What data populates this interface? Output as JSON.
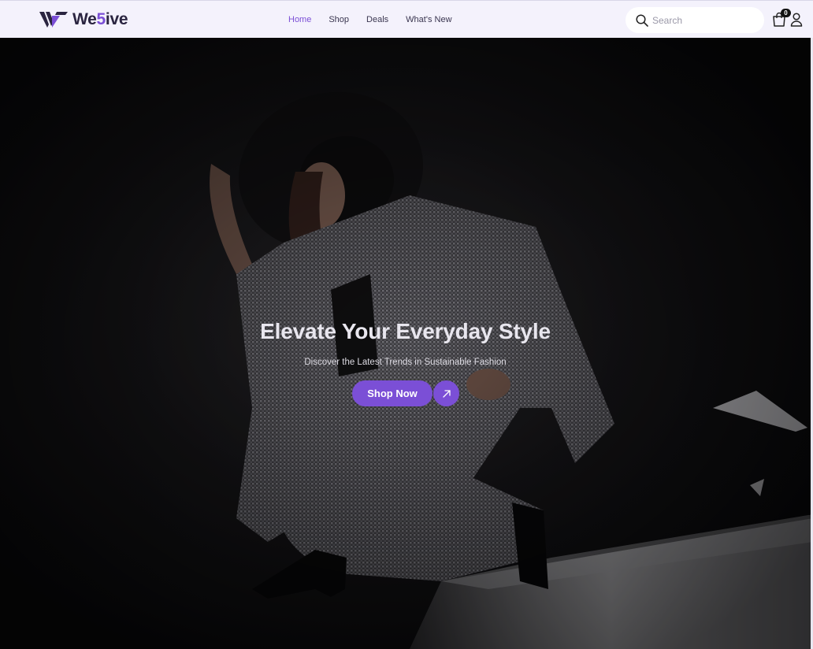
{
  "brand": {
    "name_prefix": "We",
    "name_accent": "5",
    "name_suffix": "ive",
    "accent_color": "#7b4fd6"
  },
  "nav": {
    "links": [
      {
        "label": "Home",
        "active": true
      },
      {
        "label": "Shop",
        "active": false
      },
      {
        "label": "Deals",
        "active": false
      },
      {
        "label": "What's New",
        "active": false
      }
    ]
  },
  "search": {
    "placeholder": "Search"
  },
  "cart": {
    "count": "0"
  },
  "hero": {
    "title": "Elevate Your Everyday Style",
    "subtitle": "Discover the Latest Trends in Sustainable Fashion",
    "cta_label": "Shop Now"
  }
}
